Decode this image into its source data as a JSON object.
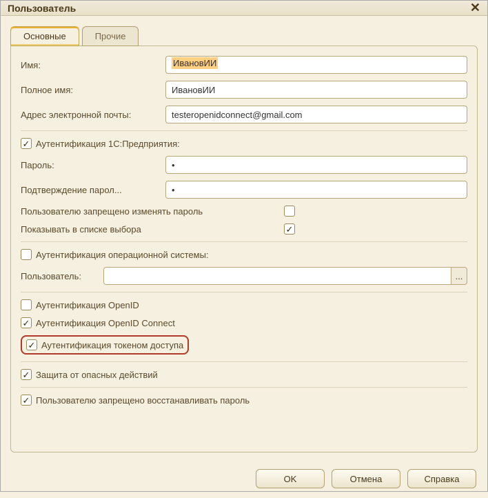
{
  "window": {
    "title": "Пользователь"
  },
  "tabs": {
    "main": "Основные",
    "other": "Прочие"
  },
  "fields": {
    "name_label": "Имя:",
    "name_value": "ИвановИИ",
    "fullname_label": "Полное имя:",
    "fullname_value": "ИвановИИ",
    "email_label": "Адрес электронной почты:",
    "email_value": "testeropenidconnect@gmail.com",
    "auth1c_label": "Аутентификация 1С:Предприятия:",
    "auth1c_checked": true,
    "password_label": "Пароль:",
    "password_value": "•",
    "password_confirm_label": "Подтверждение парол...",
    "password_confirm_value": "•",
    "cannot_change_pw_label": "Пользователю запрещено изменять пароль",
    "cannot_change_pw_checked": false,
    "show_in_list_label": "Показывать в списке выбора",
    "show_in_list_checked": true,
    "auth_os_label": "Аутентификация операционной системы:",
    "auth_os_checked": false,
    "user_label": "Пользователь:",
    "user_value": "",
    "auth_openid_label": "Аутентификация OpenID",
    "auth_openid_checked": false,
    "auth_openid_connect_label": "Аутентификация OpenID Connect",
    "auth_openid_connect_checked": true,
    "auth_token_label": "Аутентификация токеном доступа",
    "auth_token_checked": true,
    "safe_actions_label": "Защита от опасных действий",
    "safe_actions_checked": true,
    "cannot_restore_pw_label": "Пользователю запрещено восстанавливать пароль",
    "cannot_restore_pw_checked": true
  },
  "buttons": {
    "ok": "OK",
    "cancel": "Отмена",
    "help": "Справка",
    "ellipsis": "..."
  }
}
